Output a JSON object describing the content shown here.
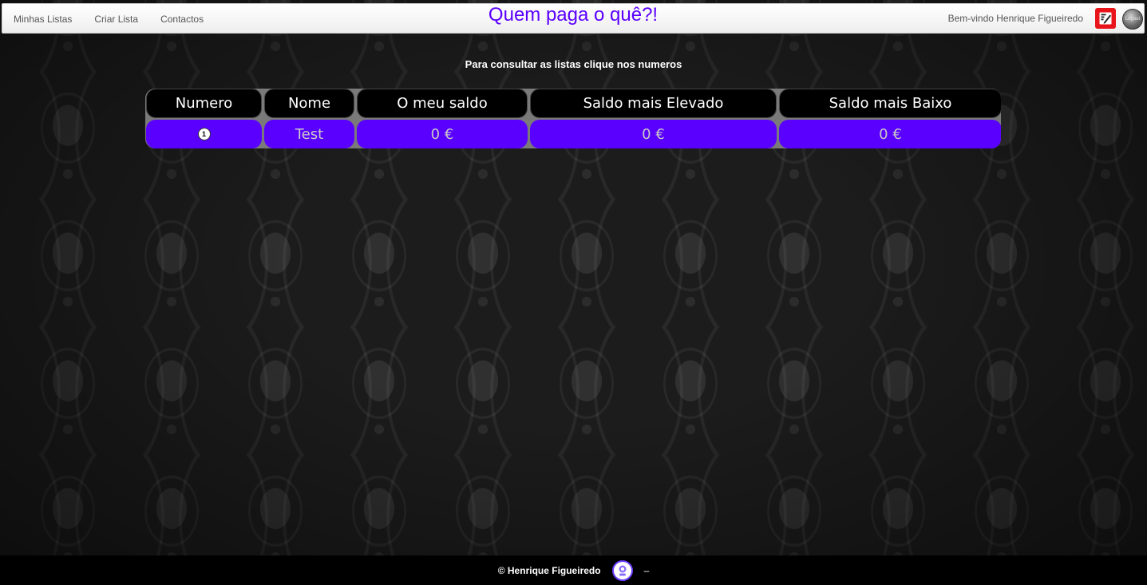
{
  "header": {
    "nav": [
      {
        "label": "Minhas Listas"
      },
      {
        "label": "Criar Lista"
      },
      {
        "label": "Contactos"
      }
    ],
    "title": "Quem paga o quê?!",
    "welcome": "Bem-vindo Henrique Figueiredo",
    "logout_label": "Logout",
    "edit_icon": "edit-icon",
    "accent_color": "#5b00ff"
  },
  "main": {
    "instruction": "Para consultar as listas clique nos numeros",
    "table": {
      "columns": [
        "Numero",
        "Nome",
        "O meu saldo",
        "Saldo mais Elevado",
        "Saldo mais Baixo"
      ],
      "rows": [
        {
          "numero": "1",
          "nome": "Test",
          "meu_saldo": "0 €",
          "saldo_elevado": "0 €",
          "saldo_baixo": "0 €"
        }
      ],
      "row_color": "#5a00ff",
      "header_color": "#000000"
    }
  },
  "footer": {
    "copyright": "© Henrique Figueiredo",
    "separator": "–"
  }
}
